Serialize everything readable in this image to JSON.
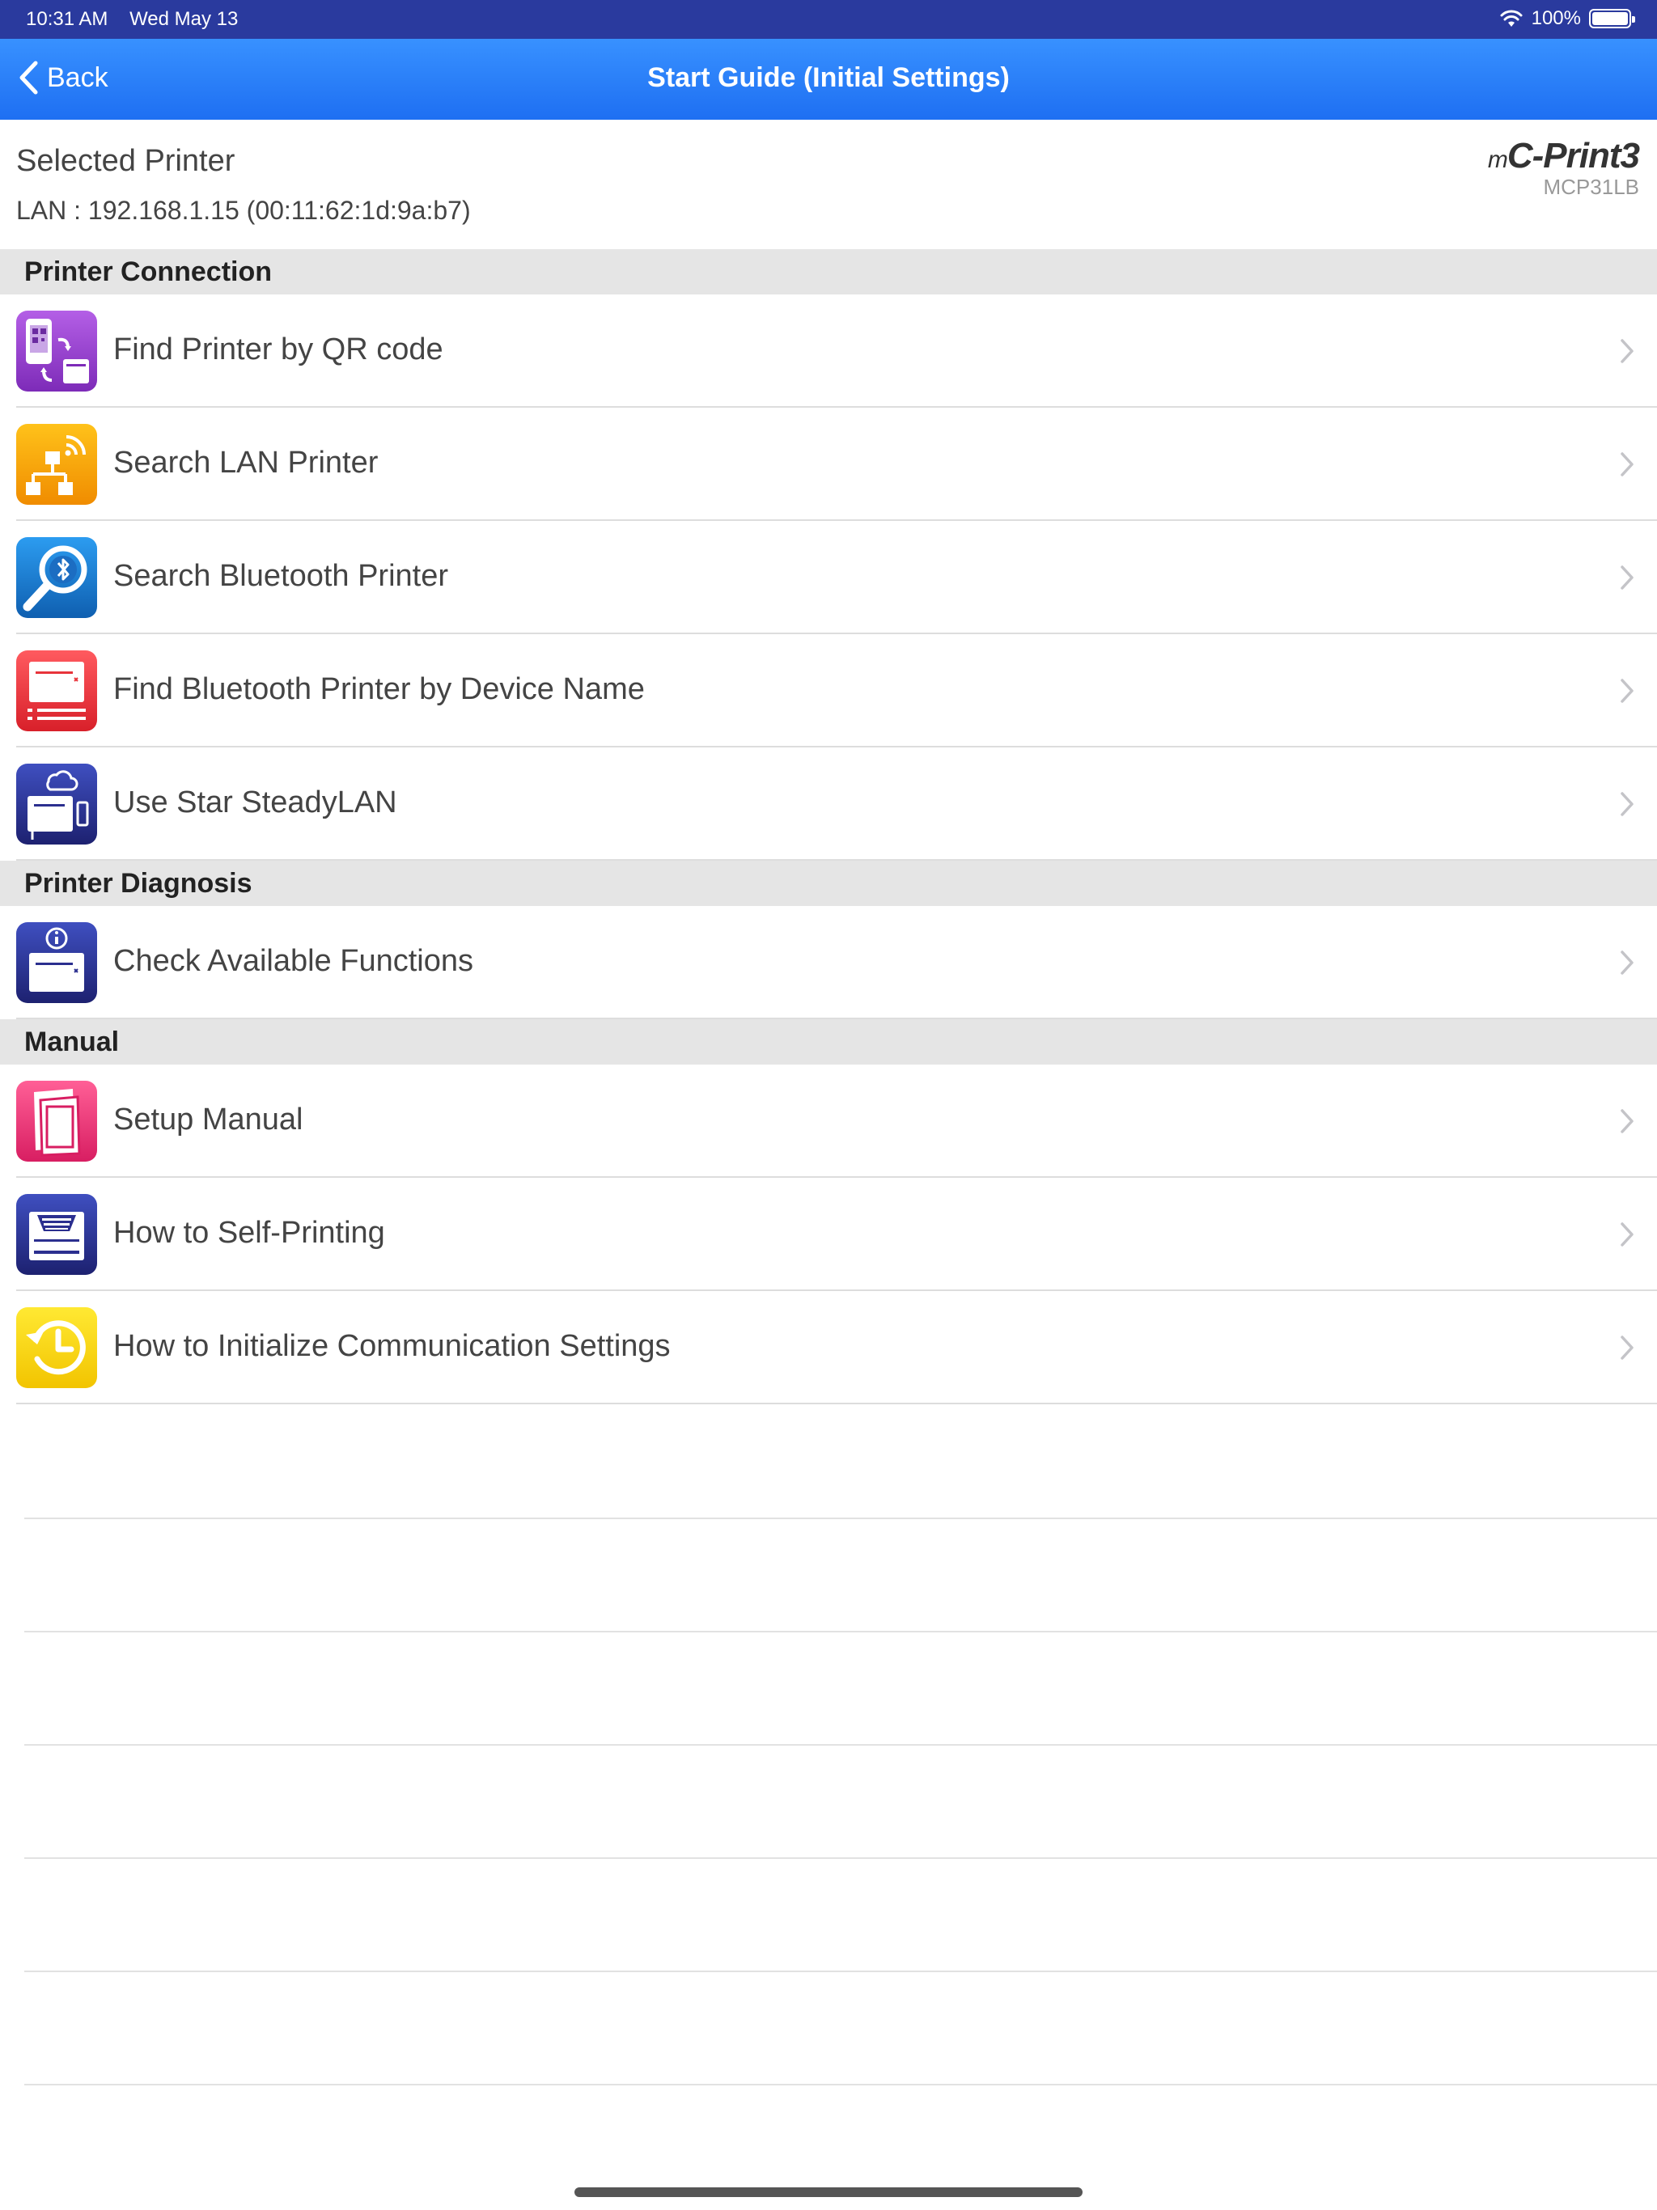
{
  "status_bar": {
    "time": "10:31 AM",
    "date": "Wed May 13",
    "battery": "100%"
  },
  "nav": {
    "back_label": "Back",
    "title": "Start Guide (Initial Settings)"
  },
  "selected_printer": {
    "label": "Selected Printer",
    "address": "LAN : 192.168.1.15 (00:11:62:1d:9a:b7)",
    "logo_prefix": "m",
    "logo": "C-Print3",
    "model": "MCP31LB"
  },
  "sections": {
    "connection": {
      "title": "Printer Connection",
      "items": [
        {
          "label": "Find Printer by QR code",
          "icon": "qr-code-icon"
        },
        {
          "label": "Search LAN Printer",
          "icon": "lan-network-icon"
        },
        {
          "label": "Search Bluetooth Printer",
          "icon": "bluetooth-search-icon"
        },
        {
          "label": "Find Bluetooth Printer by Device Name",
          "icon": "printer-list-icon"
        },
        {
          "label": "Use Star SteadyLAN",
          "icon": "steadylan-icon"
        }
      ]
    },
    "diagnosis": {
      "title": "Printer Diagnosis",
      "items": [
        {
          "label": "Check Available Functions",
          "icon": "printer-info-icon"
        }
      ]
    },
    "manual": {
      "title": "Manual",
      "items": [
        {
          "label": "Setup Manual",
          "icon": "manual-book-icon"
        },
        {
          "label": "How to Self-Printing",
          "icon": "self-print-icon"
        },
        {
          "label": "How to Initialize Communication Settings",
          "icon": "reset-clock-icon"
        }
      ]
    }
  },
  "colors": {
    "status_bar": "#2a3a9e",
    "nav_bar": "#2a7df7",
    "section_header": "#e5e5e5",
    "qr_icon": "#9b3fd0",
    "lan_icon": "#f6a000",
    "bluetooth_icon": "#1c7fd4",
    "device_name_icon": "#e8343b",
    "steadylan_icon": "#2b2f8f",
    "manual_icon": "#ec3a76",
    "reset_icon": "#f2d200"
  }
}
